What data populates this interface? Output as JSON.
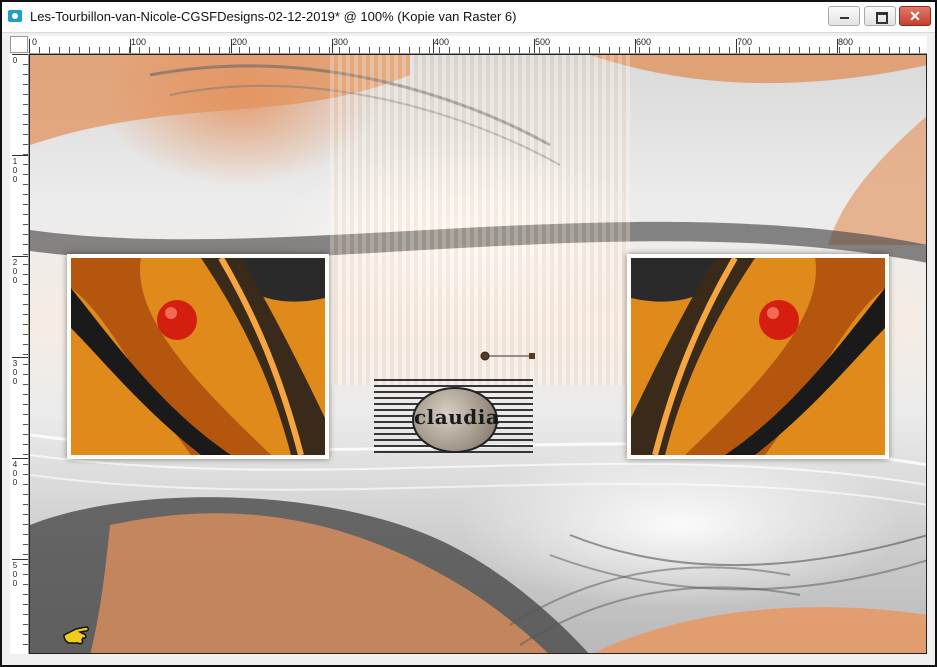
{
  "window": {
    "title": "Les-Tourbillon-van-Nicole-CGSFDesigns-02-12-2019* @ 100% (Kopie van Raster 6)",
    "controls": {
      "minimize_icon": "minimize-icon",
      "maximize_icon": "maximize-icon",
      "close_label": "✕"
    }
  },
  "ruler": {
    "horizontal_labels": [
      "0",
      "100",
      "200",
      "300",
      "400",
      "500",
      "600",
      "700",
      "800"
    ],
    "vertical_labels": [
      "0",
      "100",
      "200",
      "300",
      "400",
      "500"
    ]
  },
  "canvas": {
    "watermark_text": "claudia",
    "accent_colors": {
      "orange": "#e0935e",
      "dark": "#2b2b2b",
      "red_ball": "#d41f10"
    }
  }
}
